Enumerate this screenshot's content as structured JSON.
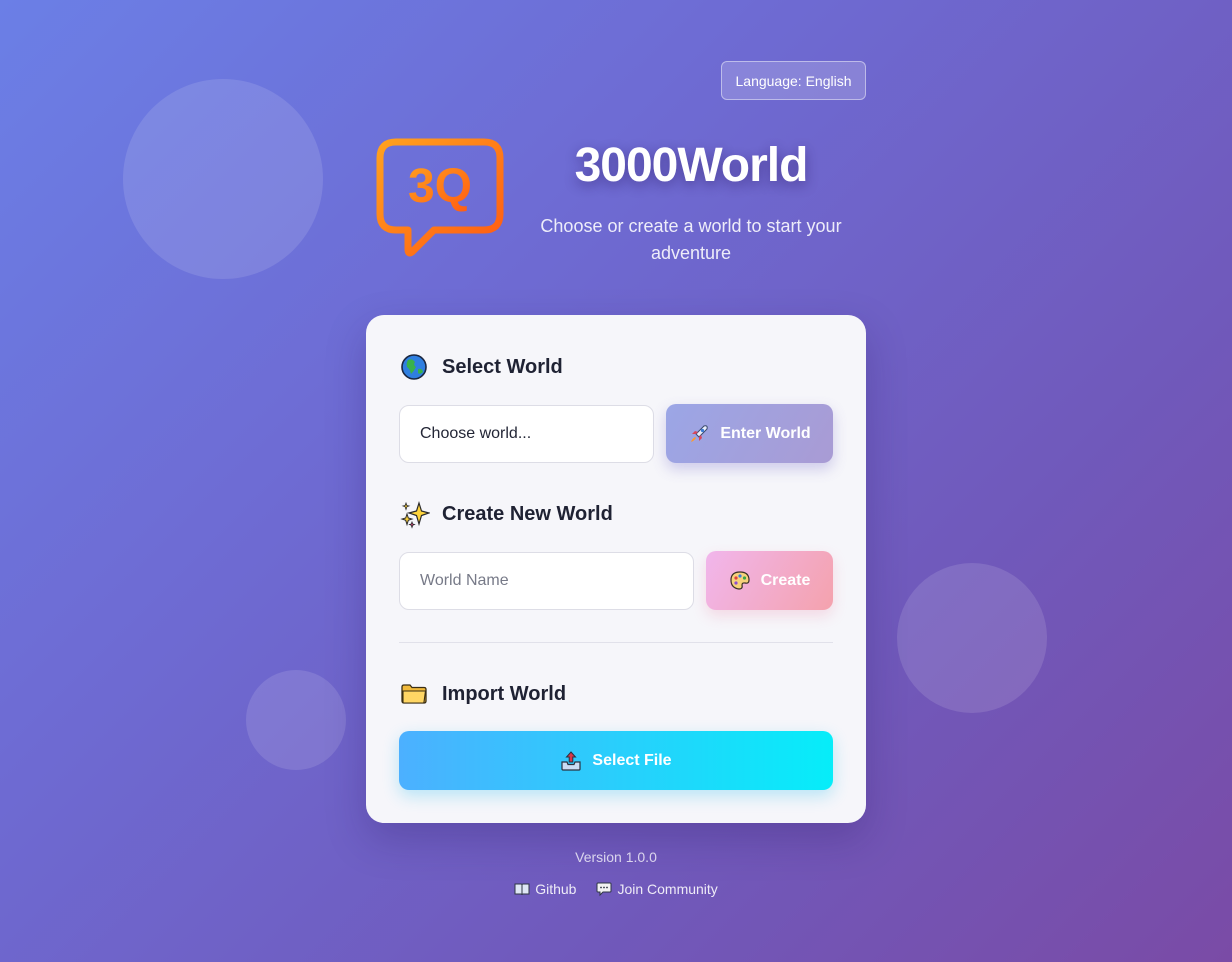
{
  "language_button": "Language: English",
  "header": {
    "logo_text": "3Q",
    "title": "3000World",
    "subtitle": "Choose or create a world to start your adventure"
  },
  "select_world": {
    "title": "Select World",
    "icon": "globe-icon",
    "select_value": "Choose world...",
    "enter_label": "Enter World",
    "enter_icon": "rocket-icon"
  },
  "create_world": {
    "title": "Create New World",
    "icon": "sparkles-icon",
    "name_placeholder": "World Name",
    "create_label": "Create",
    "create_icon": "palette-icon"
  },
  "import_world": {
    "title": "Import World",
    "icon": "folder-icon",
    "file_label": "Select File",
    "file_icon": "upload-tray-icon"
  },
  "footer": {
    "version": "Version 1.0.0",
    "links": [
      {
        "label": "Github",
        "icon": "book-icon"
      },
      {
        "label": "Join Community",
        "icon": "speech-bubble-icon"
      }
    ]
  },
  "colors": {
    "background_start": "#6b7fe6",
    "background_end": "#7a4ba6",
    "enter_button": "#9ba6e6",
    "create_button": "#f1b6ec",
    "file_button_start": "#4cb0ff",
    "file_button_end": "#06edf9",
    "logo_orange": "#ff8c1a"
  }
}
